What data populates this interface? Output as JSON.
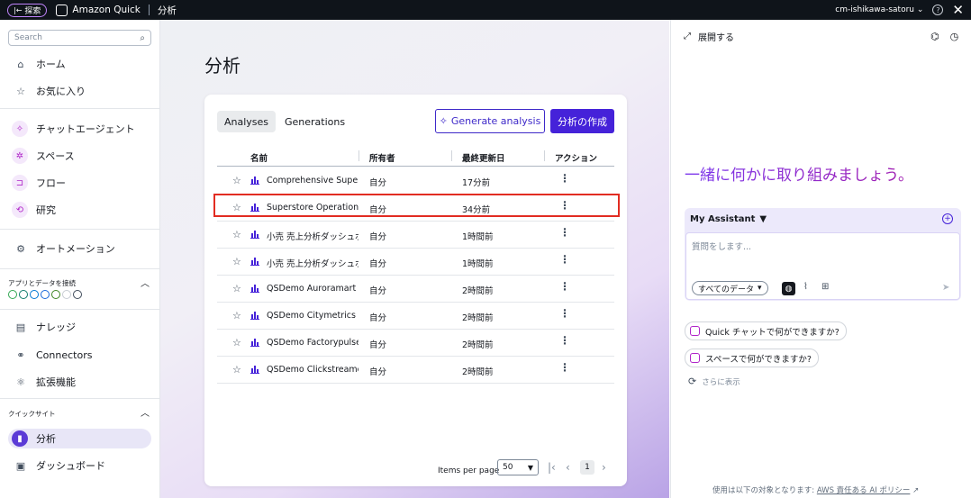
{
  "topbar": {
    "explore_label": "探索",
    "app_name": "Amazon Quick",
    "section": "分析",
    "username": "cm-ishikawa-satoru"
  },
  "sidebar": {
    "search_placeholder": "Search",
    "top_items": [
      {
        "label": "ホーム",
        "icon": "home-icon"
      },
      {
        "label": "お気に入り",
        "icon": "star-icon"
      }
    ],
    "agent_items": [
      {
        "label": "チャットエージェント",
        "icon": "sparkle-icon"
      },
      {
        "label": "スペース",
        "icon": "spaces-icon"
      },
      {
        "label": "フロー",
        "icon": "flow-icon"
      },
      {
        "label": "研究",
        "icon": "research-icon"
      }
    ],
    "automation_label": "オートメーション",
    "apps_section_label": "アプリとデータを接続",
    "connect_items": [
      {
        "label": "ナレッジ",
        "icon": "knowledge-icon"
      },
      {
        "label": "Connectors",
        "icon": "connectors-icon"
      },
      {
        "label": "拡張機能",
        "icon": "extensions-icon"
      }
    ],
    "quicksight_label": "クイックサイト",
    "quicksight_items": [
      {
        "label": "分析",
        "icon": "analysis-icon",
        "active": true
      },
      {
        "label": "ダッシュボード",
        "icon": "dashboard-icon"
      }
    ]
  },
  "main": {
    "title": "分析",
    "tabs": [
      {
        "label": "Analyses",
        "selected": true
      },
      {
        "label": "Generations",
        "selected": false
      }
    ],
    "generate_button": "Generate analysis",
    "create_button": "分析の作成",
    "columns": [
      "名前",
      "所有者",
      "最終更新日",
      "アクション"
    ],
    "rows": [
      {
        "name": "Comprehensive Superstc",
        "owner": "自分",
        "updated": "17分前"
      },
      {
        "name": "Superstore Operations &",
        "owner": "自分",
        "updated": "34分前"
      },
      {
        "name": "小売 売上分析ダッシュボ",
        "owner": "自分",
        "updated": "1時間前"
      },
      {
        "name": "小売 売上分析ダッシュボ",
        "owner": "自分",
        "updated": "1時間前"
      },
      {
        "name": "QSDemo Auroramart An",
        "owner": "自分",
        "updated": "2時間前"
      },
      {
        "name": "QSDemo Citymetrics Ana",
        "owner": "自分",
        "updated": "2時間前"
      },
      {
        "name": "QSDemo Factorypulse A",
        "owner": "自分",
        "updated": "2時間前"
      },
      {
        "name": "QSDemo Clickstreamer A",
        "owner": "自分",
        "updated": "2時間前"
      }
    ],
    "pagination": {
      "items_per_page_label": "Items per page",
      "items_per_page": "50",
      "current_page": "1"
    }
  },
  "panel": {
    "expand_label": "展開する",
    "greeting": "一緒に何かに取り組みましょう。",
    "assistant_name": "My Assistant",
    "input_placeholder": "質問をします...",
    "data_selector": "すべてのデータ",
    "suggestions": [
      "Quick チャットで何ができますか?",
      "スペースで何ができますか?"
    ],
    "show_more": "さらに表示",
    "footer_text": "使用は以下の対象となります:",
    "footer_link": "AWS 責任ある AI ポリシー"
  },
  "colors": {
    "accent": "#4522d9",
    "highlight_border": "#e22c22"
  }
}
